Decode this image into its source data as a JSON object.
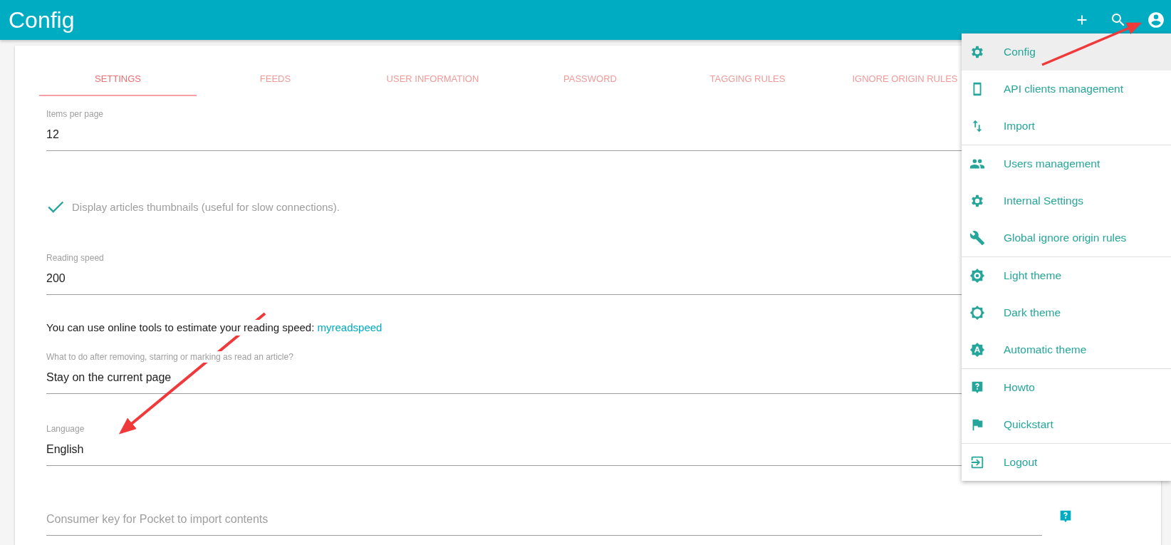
{
  "app_bar": {
    "title": "Config"
  },
  "tabs": [
    {
      "label": "SETTINGS",
      "selected": true
    },
    {
      "label": "FEEDS",
      "selected": false
    },
    {
      "label": "USER INFORMATION",
      "selected": false
    },
    {
      "label": "PASSWORD",
      "selected": false
    },
    {
      "label": "TAGGING RULES",
      "selected": false
    },
    {
      "label": "IGNORE ORIGIN RULES",
      "selected": false
    }
  ],
  "form": [
    {
      "kind": "field",
      "label": "Items per page",
      "value": "12"
    },
    {
      "kind": "checkbox",
      "label": "Display articles thumbnails (useful for slow connections).",
      "checked": true
    },
    {
      "kind": "field",
      "label": "Reading speed",
      "value": "200"
    },
    {
      "kind": "note",
      "text": "You can use online tools to estimate your reading speed: ",
      "link": "myreadspeed"
    },
    {
      "kind": "field",
      "label": "What to do after removing, starring or marking as read an article?",
      "value": "Stay on the current page"
    },
    {
      "kind": "field",
      "label": "Language",
      "value": "English"
    },
    {
      "kind": "input",
      "placeholder": "Consumer key for Pocket to import contents"
    }
  ],
  "user_menu": {
    "groups": [
      [
        {
          "label": "Config",
          "selected": true
        },
        {
          "label": "API clients management",
          "selected": false
        },
        {
          "label": "Import",
          "selected": false
        }
      ],
      [
        {
          "label": "Users management",
          "selected": false
        },
        {
          "label": "Internal Settings",
          "selected": false
        },
        {
          "label": "Global ignore origin rules",
          "selected": false
        }
      ],
      [
        {
          "label": "Light theme",
          "selected": false
        },
        {
          "label": "Dark theme",
          "selected": false
        },
        {
          "label": "Automatic theme",
          "selected": false
        }
      ],
      [
        {
          "label": "Howto",
          "selected": false
        },
        {
          "label": "Quickstart",
          "selected": false
        }
      ],
      [
        {
          "label": "Logout",
          "selected": false
        }
      ]
    ]
  }
}
